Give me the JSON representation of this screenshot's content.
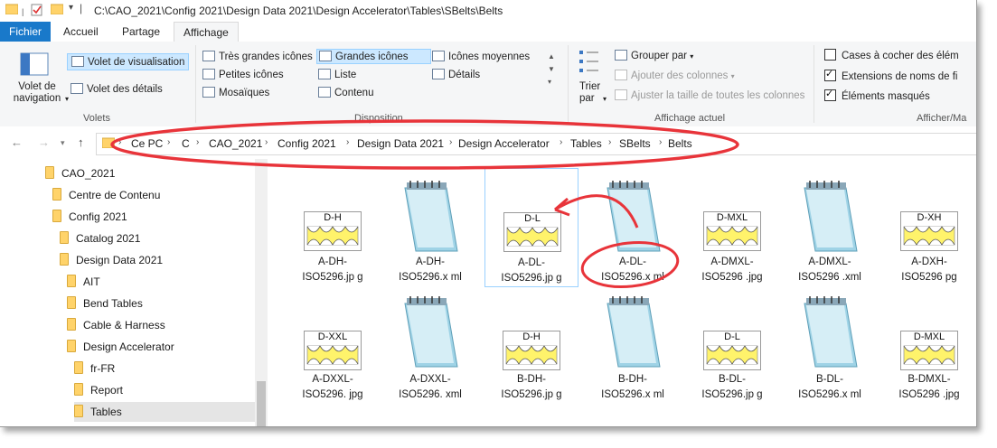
{
  "title_path": "C:\\CAO_2021\\Config 2021\\Design Data 2021\\Design Accelerator\\Tables\\SBelts\\Belts",
  "tabs": [
    "Fichier",
    "Accueil",
    "Partage",
    "Affichage"
  ],
  "ribbon": {
    "volets": {
      "nav_pane": "Volet de navigation",
      "preview_pane": "Volet de visualisation",
      "details_pane": "Volet des détails",
      "group": "Volets"
    },
    "disposition": {
      "items": [
        "Très grandes icônes",
        "Grandes icônes",
        "Icônes moyennes",
        "Petites icônes",
        "Liste",
        "Détails",
        "Mosaïques",
        "Contenu"
      ],
      "group": "Disposition"
    },
    "affichage_actuel": {
      "sort_by": "Trier par",
      "group_by": "Grouper par",
      "add_columns": "Ajouter des colonnes",
      "fit_columns": "Ajuster la taille de toutes les colonnes",
      "group": "Affichage actuel"
    },
    "afficher_masquer": {
      "checkboxes": "Cases à cocher des élém",
      "extensions": "Extensions de noms de fi",
      "hidden": "Éléments masqués",
      "group": "Afficher/Ma"
    }
  },
  "breadcrumb": [
    "Ce PC",
    "C",
    "CAO_2021",
    "Config 2021",
    "Design Data 2021",
    "Design Accelerator",
    "Tables",
    "SBelts",
    "Belts"
  ],
  "tree": [
    "CAO_2021",
    "Centre de Contenu",
    "Config 2021",
    "Catalog 2021",
    "Design Data 2021",
    "AIT",
    "Bend Tables",
    "Cable & Harness",
    "Design Accelerator",
    "fr-FR",
    "Report",
    "Tables"
  ],
  "files_row1": [
    {
      "name": "A-DH-ISO5296.jp g",
      "kind": "jpg",
      "code": "D-H"
    },
    {
      "name": "A-DH-ISO5296.x ml",
      "kind": "xml"
    },
    {
      "name": "A-DL-ISO5296.jp g",
      "kind": "jpg",
      "code": "D-L"
    },
    {
      "name": "A-DL-ISO5296.x ml",
      "kind": "xml"
    },
    {
      "name": "A-DMXL-ISO5296 .jpg",
      "kind": "jpg",
      "code": "D-MXL"
    },
    {
      "name": "A-DMXL-ISO5296 .xml",
      "kind": "xml"
    },
    {
      "name": "A-DXH-ISO5296 pg",
      "kind": "jpg",
      "code": "D-XH"
    }
  ],
  "files_row2": [
    {
      "name": "A-DXXL-ISO5296. jpg",
      "kind": "jpg",
      "code": "D-XXL"
    },
    {
      "name": "A-DXXL-ISO5296. xml",
      "kind": "xml"
    },
    {
      "name": "B-DH-ISO5296.jp g",
      "kind": "jpg",
      "code": "D-H"
    },
    {
      "name": "B-DH-ISO5296.x ml",
      "kind": "xml"
    },
    {
      "name": "B-DL-ISO5296.jp g",
      "kind": "jpg",
      "code": "D-L"
    },
    {
      "name": "B-DL-ISO5296.x ml",
      "kind": "xml"
    },
    {
      "name": "B-DMXL-ISO5296 .jpg",
      "kind": "jpg",
      "code": "D-MXL"
    }
  ],
  "colors": {
    "accent": "#1979ca",
    "annotation": "#e8343a",
    "selection": "#cce8ff"
  }
}
